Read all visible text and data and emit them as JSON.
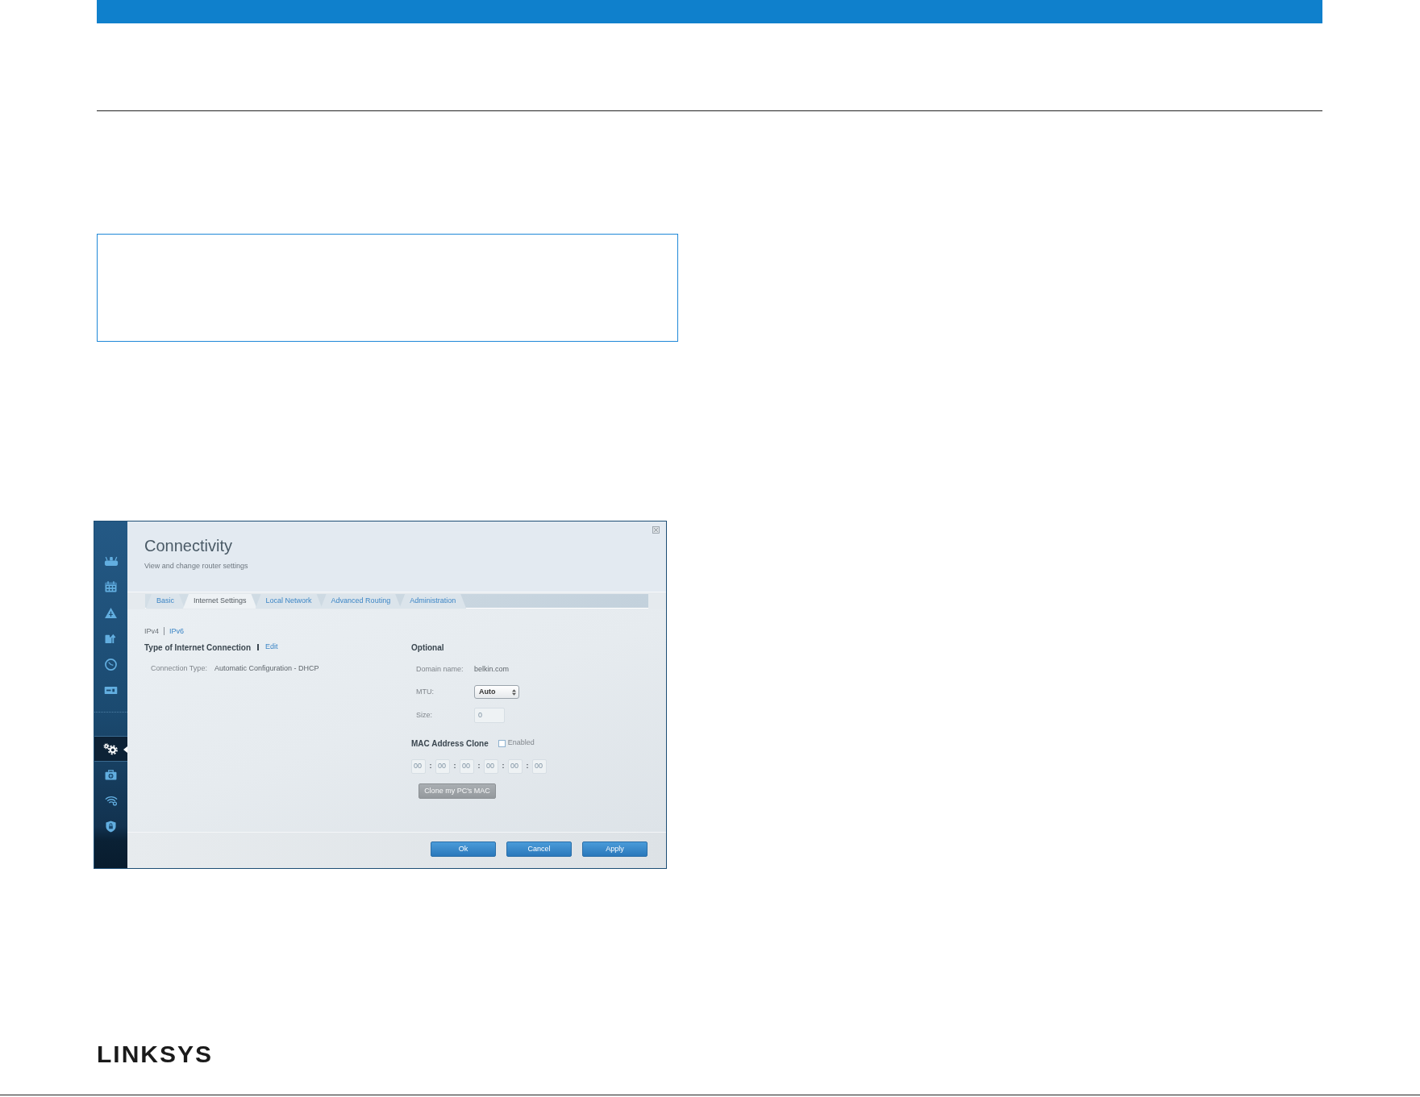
{
  "screenshot": {
    "sidebar": {
      "groups": [
        {
          "items": [
            {
              "selected": false
            },
            {
              "selected": false
            },
            {
              "selected": false
            },
            {
              "selected": false
            },
            {
              "selected": false
            },
            {
              "selected": false
            }
          ]
        },
        {
          "items": [
            {
              "selected": true
            },
            {
              "selected": false
            },
            {
              "selected": false
            },
            {
              "selected": false
            }
          ]
        }
      ]
    },
    "title": "Connectivity",
    "subtitle": "View and change router settings",
    "tabs": [
      {
        "label": "Basic",
        "selected": false
      },
      {
        "label": "Internet Settings",
        "selected": true
      },
      {
        "label": "Local Network",
        "selected": false
      },
      {
        "label": "Advanced Routing",
        "selected": false
      },
      {
        "label": "Administration",
        "selected": false
      }
    ],
    "ip_versions": [
      {
        "label": "IPv4",
        "selected": true
      },
      {
        "label": "IPv6",
        "selected": false
      }
    ],
    "connection": {
      "heading": "Type of Internet Connection",
      "edit_link": "Edit",
      "rows": [
        {
          "label": "Connection Type:",
          "value": "Automatic Configuration - DHCP"
        }
      ]
    },
    "optional": {
      "heading": "Optional",
      "rows": [
        {
          "kind": "text",
          "label": "Domain name:",
          "value": "belkin.com"
        },
        {
          "kind": "select",
          "label": "MTU:",
          "value": "Auto"
        },
        {
          "kind": "input",
          "label": "Size:",
          "value": "0",
          "disabled": true
        }
      ]
    },
    "mac_clone": {
      "heading": "MAC Address Clone",
      "checkbox": {
        "label": "Enabled",
        "checked": false
      },
      "octets": [
        {
          "value": "00",
          "disabled": true
        },
        {
          "value": "00",
          "disabled": true
        },
        {
          "value": "00",
          "disabled": true
        },
        {
          "value": "00",
          "disabled": true
        },
        {
          "value": "00",
          "disabled": true
        },
        {
          "value": "00",
          "disabled": true
        }
      ],
      "separators": [
        ":",
        ":",
        ":",
        ":",
        ":"
      ],
      "clone_button": {
        "label": "Clone my PC's MAC",
        "disabled": true
      }
    },
    "buttons": [
      "Ok",
      "Cancel",
      "Apply"
    ]
  },
  "footer": {
    "logo": "LINKSYS"
  }
}
